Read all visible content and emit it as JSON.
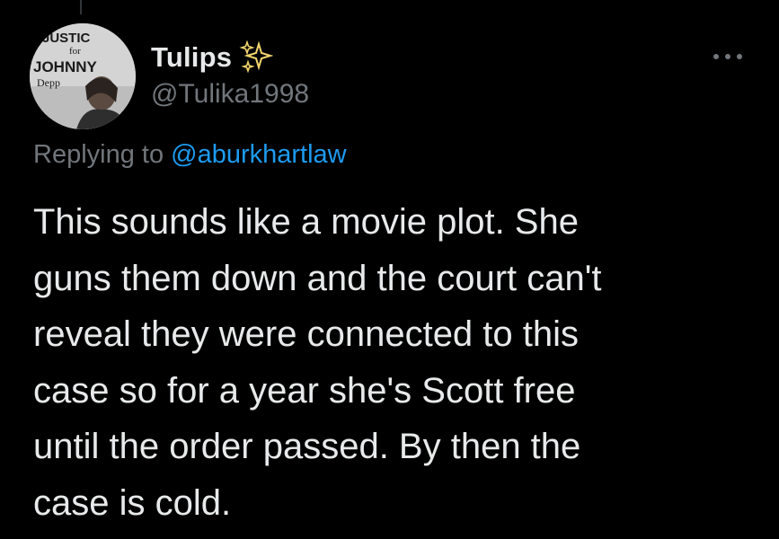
{
  "tweet": {
    "author": {
      "display_name": "Tulips",
      "name_emoji_icon": "sparkles-icon",
      "handle": "@Tulika1998",
      "avatar": {
        "line1": "JUSTIC",
        "line2": "for",
        "line3": "JOHNNY",
        "line4": "Depp"
      }
    },
    "more_icon": "more-dots-icon",
    "reply": {
      "prefix": "Replying to",
      "mention": "@aburkhartlaw"
    },
    "text": "This sounds like a movie plot. She\nguns them down and the court can't\nreveal they were connected to this\ncase so for a year she's Scott free\nuntil the order passed. By then the\ncase is cold."
  },
  "colors": {
    "background": "#000000",
    "primary_text": "#e7e9ea",
    "secondary_text": "#71767b",
    "link": "#1d9bf0",
    "sparkle": "#f5d76e"
  }
}
